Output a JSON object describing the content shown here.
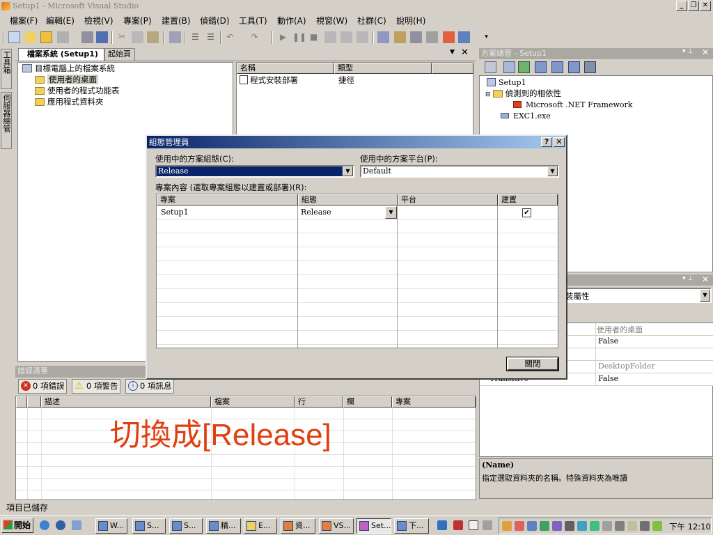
{
  "window": {
    "title": "Setup1 - Microsoft Visual Studio"
  },
  "menu": [
    "檔案(F)",
    "編輯(E)",
    "檢視(V)",
    "專案(P)",
    "建置(B)",
    "偵錯(D)",
    "工具(T)",
    "動作(A)",
    "視窗(W)",
    "社群(C)",
    "說明(H)"
  ],
  "left_strip": {
    "toolbox": "工具箱",
    "server_explorer": "伺服器總管"
  },
  "filesystem": {
    "tab_active": "檔案系統 (Setup1)",
    "tab_other": "起始頁",
    "root": "目標電腦上的檔案系統",
    "nodes": [
      "使用者的桌面",
      "使用者的程式功能表",
      "應用程式資料夾"
    ],
    "list_headers": [
      "名稱",
      "類型"
    ],
    "list_row": {
      "name": "程式安裝部署",
      "type": "捷徑"
    }
  },
  "solution_explorer": {
    "title": "方案總管 - Setup1",
    "items": [
      "Setup1",
      "偵測到的相依性",
      "Microsoft .NET Framework",
      "EXC1.exe"
    ]
  },
  "properties": {
    "combo_text": "裝屬性",
    "rows": [
      {
        "name": "",
        "value": "使用者的桌面"
      },
      {
        "name": "",
        "value": "False"
      },
      {
        "name": "",
        "value": ""
      },
      {
        "name": "",
        "value": "DesktopFolder"
      },
      {
        "name": "Transitive",
        "value": "False"
      }
    ],
    "desc_title": "(Name)",
    "desc_text": "指定選取資料夾的名稱。特殊資料夾為唯讀"
  },
  "error_list": {
    "title": "錯誤清單",
    "errors": "0 項錯誤",
    "warnings": "0 項警告",
    "messages": "0 項訊息",
    "headers": [
      "描述",
      "檔案",
      "行",
      "欄",
      "專案"
    ]
  },
  "annotation": "切換成[Release]",
  "dialog": {
    "title": "組態管理員",
    "active_config_label": "使用中的方案組態(C):",
    "active_config_value": "Release",
    "active_platform_label": "使用中的方案平台(P):",
    "active_platform_value": "Default",
    "contexts_label": "專案內容 (選取專案組態以建置或部署)(R):",
    "headers": [
      "專案",
      "組態",
      "平台",
      "建置"
    ],
    "row": {
      "project": "Setup1",
      "config": "Release",
      "platform": "",
      "build": true
    },
    "close_button": "關閉"
  },
  "status": "項目已儲存",
  "taskbar": {
    "start": "開始",
    "tasks": [
      "W...",
      "S...",
      "S...",
      "精...",
      "E...",
      "資...",
      "VS...",
      "Set...",
      "下..."
    ],
    "clock": "下午 12:10"
  },
  "colors": {
    "annotation": "#e04010",
    "dialog_title": "#0a246a",
    "selection": "#0a246a"
  }
}
